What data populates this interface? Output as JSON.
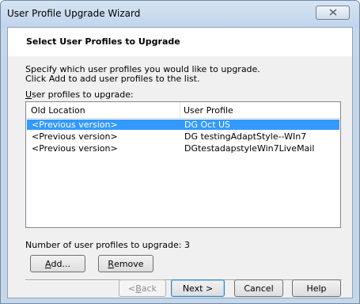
{
  "window": {
    "title": "User Profile Upgrade Wizard"
  },
  "header": {
    "title": "Select User Profiles to Upgrade"
  },
  "description": {
    "line1": "Specify which user profiles you would like to upgrade.",
    "line2": "Click Add to add user profiles to the list."
  },
  "list": {
    "label_access_key": "U",
    "label_rest": "ser profiles to upgrade:",
    "columns": [
      "Old Location",
      "User Profile"
    ],
    "rows": [
      {
        "old_location": "<Previous version>",
        "user_profile": "DG Oct US",
        "selected": true
      },
      {
        "old_location": "<Previous version>",
        "user_profile": "DG testingAdaptStyle--WIn7",
        "selected": false
      },
      {
        "old_location": "<Previous version>",
        "user_profile": "DGtestadapstyleWin7LiveMail",
        "selected": false
      }
    ]
  },
  "count": {
    "label": "Number of user profiles to upgrade:",
    "value": "3"
  },
  "buttons": {
    "add": {
      "access_key": "A",
      "rest": "dd..."
    },
    "remove": {
      "access_key": "R",
      "rest": "emove"
    },
    "back": {
      "prefix": "< ",
      "access_key": "B",
      "rest": "ack"
    },
    "next": "Next >",
    "cancel": "Cancel",
    "help": "Help"
  },
  "colors": {
    "selection": "#3399ff",
    "frame": "#c6d7ea"
  }
}
